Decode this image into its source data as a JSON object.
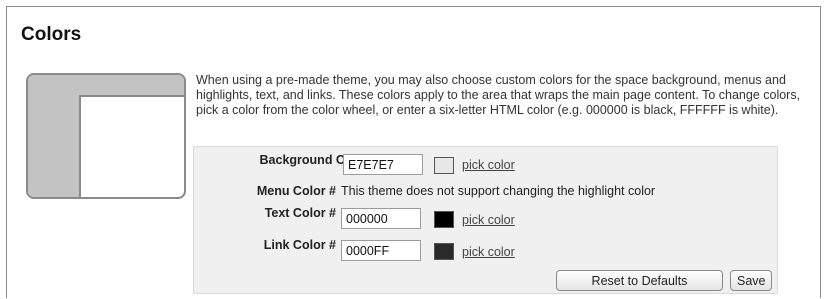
{
  "section": {
    "title": "Colors",
    "description": "When using a pre-made theme, you may also choose custom colors for the space background, menus and highlights, text, and links. These colors apply to the area that wraps the main page content. To change colors, pick a color from the color wheel, or enter a six-letter HTML color (e.g. 000000 is black, FFFFFF is white)."
  },
  "colors": {
    "background": {
      "label": "Background Color #",
      "value": "E7E7E7",
      "swatch": "#E7E7E7",
      "pick_label": "pick color"
    },
    "menu": {
      "label": "Menu Color #",
      "note": "This theme does not support changing the highlight color"
    },
    "text": {
      "label": "Text Color #",
      "value": "000000",
      "swatch": "#000000",
      "pick_label": "pick color"
    },
    "link": {
      "label": "Link Color #",
      "value": "0000FF",
      "swatch": "#2a2a2a",
      "pick_label": "pick color"
    }
  },
  "actions": {
    "reset_label": "Reset to Defaults",
    "save_label": "Save"
  }
}
